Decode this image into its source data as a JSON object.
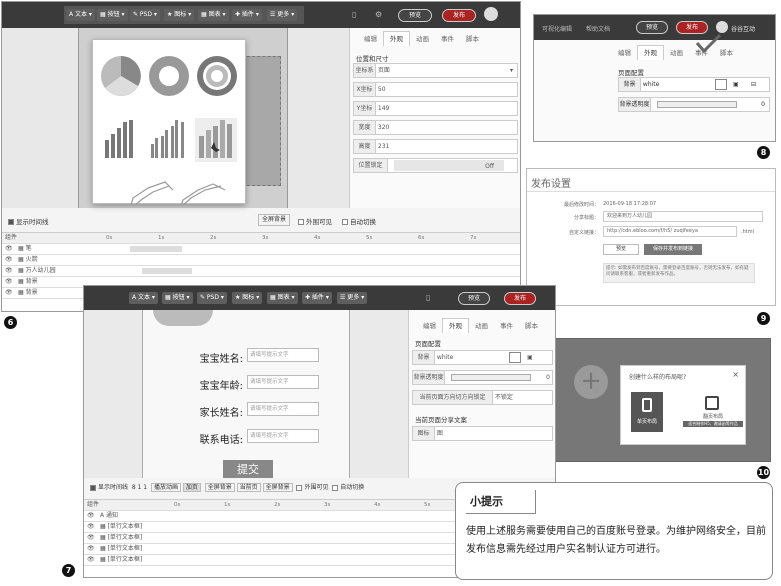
{
  "editor_main": {
    "toolbar": {
      "items": [
        "A 文本 ▾",
        "▦ 按钮 ▾",
        "✎ PSD ▾",
        "★ 图标 ▾",
        "▦ 图表 ▾",
        "✚ 插件 ▾",
        "☰ 更多 ▾"
      ],
      "preview": "预览",
      "publish": "发布"
    },
    "insert_panel": {
      "bar_labels": [
        "",
        ""
      ]
    },
    "tabs": [
      "编辑",
      "外观",
      "动画",
      "事件",
      "脚本"
    ],
    "pos_section_title": "位置和尺寸",
    "ref_label": "坐标系",
    "ref_value": "页面",
    "fields": [
      {
        "label": "X坐标",
        "value": "50"
      },
      {
        "label": "Y坐标",
        "value": "149"
      },
      {
        "label": "宽度",
        "value": "320"
      },
      {
        "label": "高度",
        "value": "231"
      }
    ],
    "lock_label": "位置锁定",
    "lock_value": "Off",
    "timeline": {
      "show_timeline": "显示时间线",
      "fullscreen": "全屏背景",
      "outside": "外围可见",
      "autoswitch": "自动切换",
      "col_header": "组件",
      "ticks": [
        "0s",
        "1s",
        "2s",
        "3s",
        "4s",
        "5s",
        "6s",
        "7s"
      ],
      "rows": [
        "▦ 笔",
        "▦ 火箭",
        "▦ 万人幼儿园",
        "▦ 背景",
        "▦ 背景"
      ]
    }
  },
  "badges": [
    "6",
    "7",
    "8",
    "9",
    "10"
  ],
  "shot8": {
    "top_left": "可视化编辑",
    "top_mid": "帮助文档",
    "preview": "预览",
    "publish": "发布",
    "user": "谷谷互动",
    "tabs": [
      "编辑",
      "外观",
      "动画",
      "事件",
      "脚本"
    ],
    "section": "页面配置",
    "bg_label": "背景",
    "bg_value": "white",
    "opacity_label": "背景透明度",
    "opacity_value": "0"
  },
  "shot9": {
    "title": "发布设置",
    "rows": [
      {
        "label": "最后修改时间：",
        "value": "2016-09-18 17:28:07"
      },
      {
        "label": "分享标题：",
        "value": "欢迎来到万人幼儿园"
      },
      {
        "label": "自定义链接：",
        "value": "http://cdn.ebloo.com/f/h5/ zuqifeeya",
        "suffix": ".html"
      }
    ],
    "preview_btn": "预览",
    "save_btn": "保存并发布到链接",
    "note": "提示: 如需发布到百度账号，需要登录百度账号，否则无法发布，如有疑问请联系客服，或者重新发布作品。"
  },
  "shot10": {
    "dialog_title": "创建什么样的布局呢?",
    "close": "×",
    "option1": "单页布局",
    "option2": "翻页布局",
    "hint": "适合制作H5、邀请函等作品"
  },
  "shot7": {
    "toolbar_items": [
      "A 文本 ▾",
      "▦ 按钮 ▾",
      "✎ PSD ▾",
      "★ 图标 ▾",
      "▦ 图表 ▾",
      "✚ 插件 ▾",
      "☰ 更多 ▾"
    ],
    "preview": "预览",
    "publish": "发布",
    "form": [
      {
        "label": "宝宝姓名:",
        "placeholder": "请填写提示文字"
      },
      {
        "label": "宝宝年龄:",
        "placeholder": "请填写提示文字"
      },
      {
        "label": "家长姓名:",
        "placeholder": "请填写提示文字"
      },
      {
        "label": "联系电话:",
        "placeholder": "请填写提示文字"
      }
    ],
    "submit": "提交",
    "tabs": [
      "编辑",
      "外观",
      "动画",
      "事件",
      "脚本"
    ],
    "section": "页面配置",
    "bg_label": "背景",
    "bg_value": "white",
    "opacity_label": "背景透明度",
    "opacity_value": "0",
    "orient_label": "当前页面方向切方向锁定",
    "orient_value": "不锁定",
    "share_title": "当前页面分享文案",
    "share_label": "图标",
    "share_value": "图",
    "timeline_opts": [
      "显示时间线",
      "8 1 1",
      "播放动画",
      "加页",
      "全屏背景",
      "当前页",
      "全屏背景",
      "外围可见",
      "自动切换"
    ],
    "col_header": "组件",
    "ticks": [
      "0s",
      "1s",
      "2s",
      "3s",
      "4s",
      "5s"
    ],
    "rows": [
      "A 通知",
      "▦ [单行文本框]",
      "▦ [单行文本框]",
      "▦ [单行文本框]",
      "▦ [单行文本框]"
    ]
  },
  "tip": {
    "title": "小提示",
    "body": "使用上述服务需要使用自己的百度账号登录。为维护网络安全，目前发布信息需先经过用户实名制认证方可进行。"
  }
}
